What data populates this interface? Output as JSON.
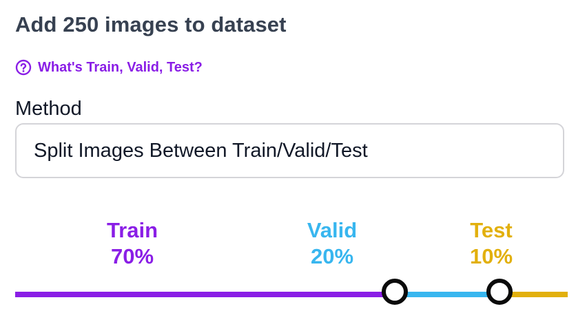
{
  "title": "Add 250 images to dataset",
  "help_link": {
    "icon": "question-circle-icon",
    "label": "What's Train, Valid, Test?"
  },
  "method": {
    "label": "Method",
    "selected": "Split Images Between Train/Valid/Test"
  },
  "splits": [
    {
      "name": "Train",
      "percent_label": "70%",
      "percent": 70,
      "color": "#8a1ee6"
    },
    {
      "name": "Valid",
      "percent_label": "20%",
      "percent": 20,
      "color": "#38b6ef"
    },
    {
      "name": "Test",
      "percent_label": "10%",
      "percent": 10,
      "color": "#e2b00d"
    }
  ],
  "slider": {
    "handle_positions_percent": [
      70,
      90
    ]
  }
}
